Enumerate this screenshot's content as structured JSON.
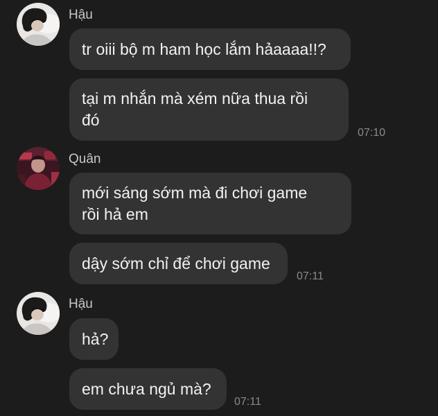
{
  "conversation": {
    "groups": [
      {
        "sender": "Hậu",
        "avatar_icon": "avatar-hau-icon",
        "messages": [
          {
            "text": "tr oiii bộ m ham học lắm hảaaaa!!?"
          },
          {
            "text": "tại m nhắn mà xém nữa thua rồi\nđó"
          }
        ],
        "time": "07:10"
      },
      {
        "sender": "Quân",
        "avatar_icon": "avatar-quan-icon",
        "messages": [
          {
            "text": "mới sáng sớm mà đi chơi game\nrồi hả em"
          },
          {
            "text": "dậy sớm chỉ để chơi game"
          }
        ],
        "time": "07:11"
      },
      {
        "sender": "Hậu",
        "avatar_icon": "avatar-hau-icon",
        "messages": [
          {
            "text": "hả?"
          },
          {
            "text": "em chưa ngủ mà?"
          }
        ],
        "time": "07:11"
      }
    ]
  },
  "colors": {
    "background": "#1c1c1c",
    "bubble": "#333334",
    "message_text": "#f2f2f2",
    "sender_text": "#c8c8c8",
    "timestamp_text": "#8a8a8a"
  }
}
